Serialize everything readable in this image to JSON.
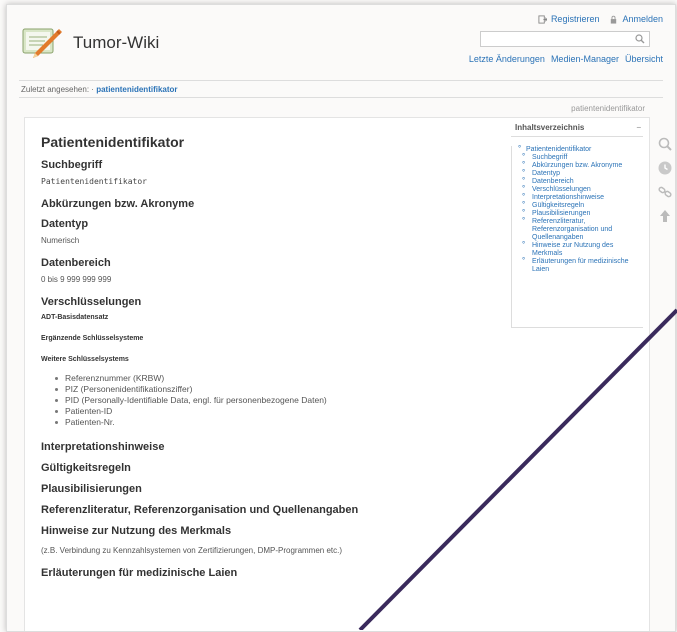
{
  "site": {
    "title": "Tumor-Wiki"
  },
  "usertools": {
    "register": "Registrieren",
    "login": "Anmelden"
  },
  "sitetools": {
    "recent": "Letzte Änderungen",
    "media": "Medien-Manager",
    "index": "Übersicht"
  },
  "breadcrumbs": {
    "label": "Zuletzt angesehen:",
    "sep": "·",
    "current": "patientenidentifikator"
  },
  "page_id": "patientenidentifikator",
  "content": {
    "title": "Patientenidentifikator",
    "suchbegriff_h": "Suchbegriff",
    "suchbegriff": "Patientenidentifikator",
    "abk_h": "Abkürzungen bzw. Akronyme",
    "datentyp_h": "Datentyp",
    "datentyp": "Numerisch",
    "datenbereich_h": "Datenbereich",
    "datenbereich": "0 bis 9 999 999 999",
    "versch_h": "Verschlüsselungen",
    "adt": "ADT-Basisdatensatz",
    "ergaenzend": "Ergänzende Schlüsselsysteme",
    "weitere": "Weitere Schlüsselsystems",
    "items": [
      "Referenznummer (KRBW)",
      "PIZ (Personenidentifikationsziffer)",
      "PID (Personally-Identifiable Data, engl. für personenbezogene Daten)",
      "Patienten-ID",
      "Patienten-Nr."
    ],
    "interp_h": "Interpretationshinweise",
    "gueltig_h": "Gültigkeitsregeln",
    "plaus_h": "Plausibilisierungen",
    "ref_h": "Referenzliteratur, Referenzorganisation und Quellenangaben",
    "hinweise_h": "Hinweise zur Nutzung des Merkmals",
    "hinweise": "(z.B. Verbindung zu Kennzahlsystemen von Zertifizierungen, DMP-Programmen etc.)",
    "erl_h": "Erläuterungen für medizinische Laien"
  },
  "toc": {
    "title": "Inhaltsverzeichnis",
    "toggle": "−",
    "top": "Patientenidentifikator",
    "items": [
      "Suchbegriff",
      "Abkürzungen bzw. Akronyme",
      "Datentyp",
      "Datenbereich",
      "Verschlüsselungen",
      "Interpretationshinweise",
      "Gültigkeitsregeln",
      "Plausibilisierungen",
      "Referenzliteratur, Referenzorganisation und Quellenangaben",
      "Hinweise zur Nutzung des Merkmals",
      "Erläuterungen für medizinische Laien"
    ]
  },
  "colors": {
    "link": "#2b73b7",
    "annotation_line": "#3a2a5c"
  },
  "icons": [
    "wiki-logo-icon",
    "register-icon",
    "lock-icon",
    "search-icon",
    "magnifier-icon",
    "revisions-icon",
    "backlinks-icon",
    "back-to-top-icon"
  ]
}
